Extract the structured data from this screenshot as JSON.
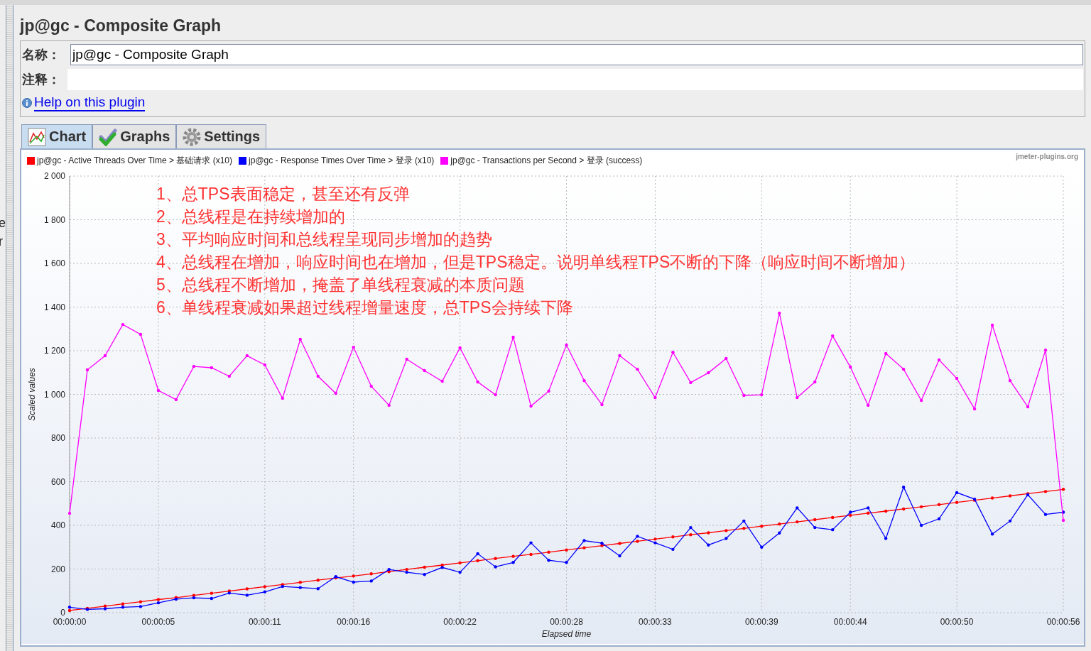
{
  "left_pane": {
    "texts": [
      "e",
      "r"
    ]
  },
  "panel": {
    "title": "jp@gc - Composite Graph",
    "name_field": {
      "label": "名称：",
      "value": "jp@gc - Composite Graph"
    },
    "comment_field": {
      "label": "注释："
    },
    "help_link": "Help on this plugin"
  },
  "tabs": [
    {
      "label": "Chart",
      "selected": true,
      "kind": "chart"
    },
    {
      "label": "Graphs",
      "selected": false,
      "kind": "check"
    },
    {
      "label": "Settings",
      "selected": false,
      "kind": "gear"
    }
  ],
  "chart": {
    "credit": "jmeter-plugins.org",
    "notes": [
      "1、总TPS表面稳定，甚至还有反弹",
      "2、总线程是在持续增加的",
      "3、平均响应时间和总线程呈现同步增加的趋势",
      "4、总线程在增加，响应时间也在增加，但是TPS稳定。说明单线程TPS不断的下降（响应时间不断增加）",
      "5、总线程不断增加，掩盖了单线程衰减的本质问题",
      "6、单线程衰减如果超过线程增量速度，总TPS会持续下降"
    ],
    "chart_data": {
      "type": "line",
      "grid": true,
      "legend": true,
      "xlabel": "Elapsed time",
      "ylabel": "Scaled values",
      "xlim": [
        0,
        56
      ],
      "ylim": [
        0,
        2000
      ],
      "xticks": [
        {
          "value": 0,
          "label": "00:00:00"
        },
        {
          "value": 5,
          "label": "00:00:05"
        },
        {
          "value": 11,
          "label": "00:00:11"
        },
        {
          "value": 16,
          "label": "00:00:16"
        },
        {
          "value": 22,
          "label": "00:00:22"
        },
        {
          "value": 28,
          "label": "00:00:28"
        },
        {
          "value": 33,
          "label": "00:00:33"
        },
        {
          "value": 39,
          "label": "00:00:39"
        },
        {
          "value": 44,
          "label": "00:00:44"
        },
        {
          "value": 50,
          "label": "00:00:50"
        },
        {
          "value": 56,
          "label": "00:00:56"
        }
      ],
      "yticks": [
        {
          "value": 0,
          "label": "0"
        },
        {
          "value": 200,
          "label": "200"
        },
        {
          "value": 400,
          "label": "400"
        },
        {
          "value": 600,
          "label": "600"
        },
        {
          "value": 800,
          "label": "800"
        },
        {
          "value": 1000,
          "label": "1 000"
        },
        {
          "value": 1200,
          "label": "1 200"
        },
        {
          "value": 1400,
          "label": "1 400"
        },
        {
          "value": 1600,
          "label": "1 600"
        },
        {
          "value": 1800,
          "label": "1 800"
        },
        {
          "value": 2000,
          "label": "2 000"
        }
      ],
      "x": [
        0,
        1,
        2,
        3,
        4,
        5,
        6,
        7,
        8,
        9,
        10,
        11,
        12,
        13,
        14,
        15,
        16,
        17,
        18,
        19,
        20,
        21,
        22,
        23,
        24,
        25,
        26,
        27,
        28,
        29,
        30,
        31,
        32,
        33,
        34,
        35,
        36,
        37,
        38,
        39,
        40,
        41,
        42,
        43,
        44,
        45,
        46,
        47,
        48,
        49,
        50,
        51,
        52,
        53,
        54,
        55,
        56
      ],
      "series": [
        {
          "name": "jp@gc - Active Threads Over Time > 基础请求 (x10)",
          "color": "#ff0000",
          "values": [
            10,
            20,
            30,
            40,
            50,
            60,
            69,
            79,
            89,
            99,
            109,
            119,
            129,
            139,
            149,
            159,
            168,
            178,
            188,
            198,
            208,
            218,
            228,
            238,
            248,
            258,
            267,
            277,
            287,
            297,
            307,
            317,
            327,
            337,
            347,
            357,
            366,
            376,
            386,
            396,
            406,
            416,
            426,
            436,
            446,
            456,
            465,
            475,
            485,
            495,
            505,
            515,
            525,
            535,
            545,
            555,
            565
          ]
        },
        {
          "name": "jp@gc - Response Times Over Time > 登录 (x10)",
          "color": "#0000ff",
          "values": [
            25,
            15,
            18,
            25,
            28,
            45,
            62,
            68,
            65,
            90,
            80,
            95,
            120,
            115,
            110,
            165,
            140,
            145,
            198,
            185,
            175,
            207,
            185,
            270,
            210,
            230,
            320,
            240,
            230,
            330,
            318,
            260,
            350,
            320,
            290,
            390,
            310,
            340,
            420,
            300,
            365,
            480,
            390,
            380,
            460,
            480,
            340,
            575,
            400,
            430,
            550,
            520,
            360,
            420,
            540,
            450,
            460
          ]
        },
        {
          "name": "jp@gc - Transactions per Second > 登录 (success)",
          "color": "#ff00ff",
          "values": [
            455,
            1112,
            1177,
            1320,
            1275,
            1018,
            976,
            1128,
            1122,
            1083,
            1177,
            1135,
            982,
            1252,
            1083,
            1005,
            1216,
            1037,
            950,
            1161,
            1109,
            1060,
            1213,
            1057,
            998,
            1262,
            946,
            1015,
            1226,
            1063,
            953,
            1177,
            1115,
            985,
            1193,
            1054,
            1099,
            1164,
            995,
            998,
            1372,
            985,
            1057,
            1268,
            1125,
            950,
            1187,
            1115,
            972,
            1158,
            1073,
            933,
            1317,
            1063,
            943,
            1203,
            423
          ]
        }
      ]
    }
  }
}
